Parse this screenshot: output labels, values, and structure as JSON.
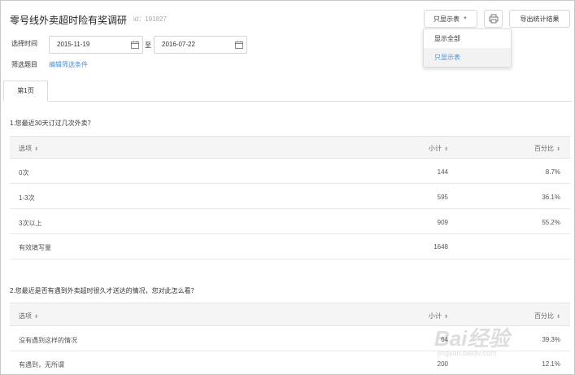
{
  "header": {
    "title": "零号线外卖超时险有奖调研",
    "survey_id": "id：191827",
    "filter_button": "只显示表",
    "export_button": "导出统计结果"
  },
  "dropdown": {
    "items": [
      {
        "label": "显示全部"
      },
      {
        "label": "只显示表"
      }
    ]
  },
  "filters": {
    "time_label": "选择时间",
    "start_date": "2015-11-19",
    "to_label": "至",
    "end_date": "2016-07-22",
    "question_filter_label": "筛选题目",
    "edit_conditions_link": "编辑筛选条件"
  },
  "tabs": [
    {
      "label": "第1页"
    }
  ],
  "questions": [
    {
      "title": "1.您最近30天订过几次外卖？",
      "columns": [
        "选项",
        "小计",
        "百分比"
      ],
      "rows": [
        {
          "option": "0次",
          "count": "144",
          "percent": "8.7%"
        },
        {
          "option": "1-3次",
          "count": "595",
          "percent": "36.1%"
        },
        {
          "option": "3次以上",
          "count": "909",
          "percent": "55.2%"
        },
        {
          "option": "有效填写量",
          "count": "1648",
          "percent": ""
        }
      ]
    },
    {
      "title": "2.您最近是否有遇到外卖超时很久才送达的情况，您对此怎么看？",
      "columns": [
        "选项",
        "小计",
        "百分比"
      ],
      "rows": [
        {
          "option": "没有遇到这样的情况",
          "count": "64",
          "percent": "39.3%"
        },
        {
          "option": "有遇到，无所谓",
          "count": "200",
          "percent": "12.1%"
        }
      ]
    }
  ],
  "watermark": {
    "brand": "Bai经验",
    "url": "jingyan.baidu.com"
  }
}
